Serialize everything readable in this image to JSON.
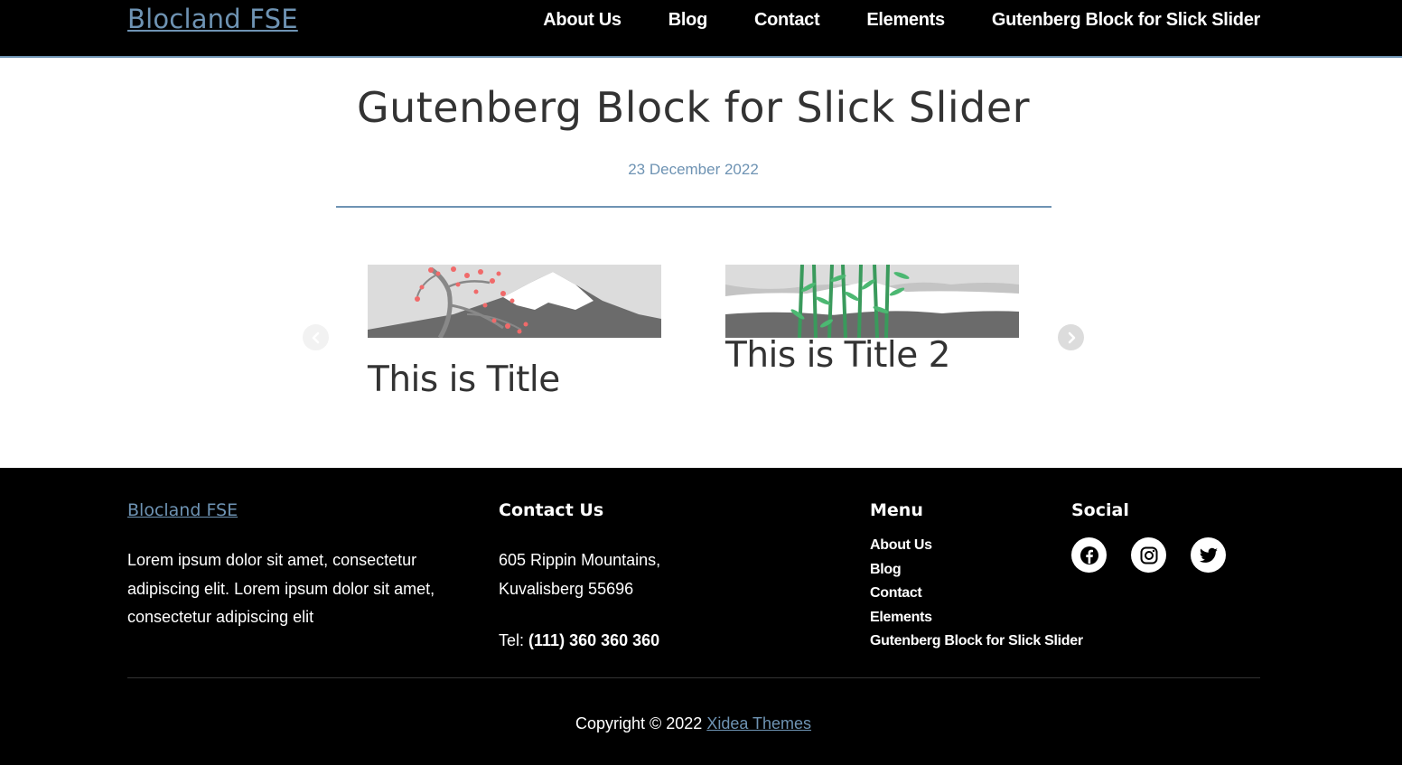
{
  "header": {
    "site_title": "Blocland FSE",
    "nav": [
      "About Us",
      "Blog",
      "Contact",
      "Elements",
      "Gutenberg Block for Slick Slider"
    ]
  },
  "post": {
    "title": "Gutenberg Block for Slick Slider",
    "date": "23 December 2022"
  },
  "slider": {
    "slides": [
      {
        "title": "This is Title",
        "image": "cherry-blossom-mountain-image"
      },
      {
        "title": "This is Title 2",
        "image": "bamboo-mountain-image"
      }
    ],
    "prev_icon": "chevron-left-circle-icon",
    "next_icon": "chevron-right-circle-icon"
  },
  "footer": {
    "brand": {
      "title": "Blocland FSE",
      "text": "Lorem ipsum dolor sit amet, consectetur adipiscing elit. Lorem ipsum dolor sit amet, consectetur adipiscing elit"
    },
    "contact": {
      "heading": "Contact Us",
      "address_line1": "605 Rippin Mountains,",
      "address_line2": "Kuvalisberg 55696",
      "tel_label": "Tel:",
      "tel_value": "(111) 360 360 360"
    },
    "menu": {
      "heading": "Menu",
      "items": [
        "About Us",
        "Blog",
        "Contact",
        "Elements",
        "Gutenberg Block for Slick Slider"
      ]
    },
    "social": {
      "heading": "Social",
      "icons": [
        "facebook-icon",
        "instagram-icon",
        "twitter-icon"
      ]
    },
    "copyright_text": "Copyright © 2022",
    "copyright_link": "Xidea Themes"
  },
  "colors": {
    "accent": "#6e93b3",
    "header_bg": "#000000",
    "footer_bg": "#000000",
    "text": "#333333",
    "cherry_blossom": "#f06a6a",
    "bamboo": "#3a9a5c"
  }
}
